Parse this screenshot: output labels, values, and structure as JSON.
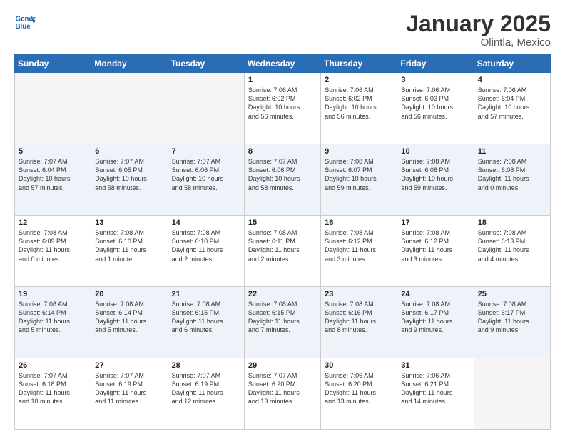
{
  "header": {
    "logo_line1": "General",
    "logo_line2": "Blue",
    "title": "January 2025",
    "subtitle": "Olintla, Mexico"
  },
  "weekdays": [
    "Sunday",
    "Monday",
    "Tuesday",
    "Wednesday",
    "Thursday",
    "Friday",
    "Saturday"
  ],
  "weeks": [
    [
      {
        "day": "",
        "info": ""
      },
      {
        "day": "",
        "info": ""
      },
      {
        "day": "",
        "info": ""
      },
      {
        "day": "1",
        "info": "Sunrise: 7:06 AM\nSunset: 6:02 PM\nDaylight: 10 hours\nand 56 minutes."
      },
      {
        "day": "2",
        "info": "Sunrise: 7:06 AM\nSunset: 6:02 PM\nDaylight: 10 hours\nand 56 minutes."
      },
      {
        "day": "3",
        "info": "Sunrise: 7:06 AM\nSunset: 6:03 PM\nDaylight: 10 hours\nand 56 minutes."
      },
      {
        "day": "4",
        "info": "Sunrise: 7:06 AM\nSunset: 6:04 PM\nDaylight: 10 hours\nand 57 minutes."
      }
    ],
    [
      {
        "day": "5",
        "info": "Sunrise: 7:07 AM\nSunset: 6:04 PM\nDaylight: 10 hours\nand 57 minutes."
      },
      {
        "day": "6",
        "info": "Sunrise: 7:07 AM\nSunset: 6:05 PM\nDaylight: 10 hours\nand 58 minutes."
      },
      {
        "day": "7",
        "info": "Sunrise: 7:07 AM\nSunset: 6:06 PM\nDaylight: 10 hours\nand 58 minutes."
      },
      {
        "day": "8",
        "info": "Sunrise: 7:07 AM\nSunset: 6:06 PM\nDaylight: 10 hours\nand 58 minutes."
      },
      {
        "day": "9",
        "info": "Sunrise: 7:08 AM\nSunset: 6:07 PM\nDaylight: 10 hours\nand 59 minutes."
      },
      {
        "day": "10",
        "info": "Sunrise: 7:08 AM\nSunset: 6:08 PM\nDaylight: 10 hours\nand 59 minutes."
      },
      {
        "day": "11",
        "info": "Sunrise: 7:08 AM\nSunset: 6:08 PM\nDaylight: 11 hours\nand 0 minutes."
      }
    ],
    [
      {
        "day": "12",
        "info": "Sunrise: 7:08 AM\nSunset: 6:09 PM\nDaylight: 11 hours\nand 0 minutes."
      },
      {
        "day": "13",
        "info": "Sunrise: 7:08 AM\nSunset: 6:10 PM\nDaylight: 11 hours\nand 1 minute."
      },
      {
        "day": "14",
        "info": "Sunrise: 7:08 AM\nSunset: 6:10 PM\nDaylight: 11 hours\nand 2 minutes."
      },
      {
        "day": "15",
        "info": "Sunrise: 7:08 AM\nSunset: 6:11 PM\nDaylight: 11 hours\nand 2 minutes."
      },
      {
        "day": "16",
        "info": "Sunrise: 7:08 AM\nSunset: 6:12 PM\nDaylight: 11 hours\nand 3 minutes."
      },
      {
        "day": "17",
        "info": "Sunrise: 7:08 AM\nSunset: 6:12 PM\nDaylight: 11 hours\nand 3 minutes."
      },
      {
        "day": "18",
        "info": "Sunrise: 7:08 AM\nSunset: 6:13 PM\nDaylight: 11 hours\nand 4 minutes."
      }
    ],
    [
      {
        "day": "19",
        "info": "Sunrise: 7:08 AM\nSunset: 6:14 PM\nDaylight: 11 hours\nand 5 minutes."
      },
      {
        "day": "20",
        "info": "Sunrise: 7:08 AM\nSunset: 6:14 PM\nDaylight: 11 hours\nand 5 minutes."
      },
      {
        "day": "21",
        "info": "Sunrise: 7:08 AM\nSunset: 6:15 PM\nDaylight: 11 hours\nand 6 minutes."
      },
      {
        "day": "22",
        "info": "Sunrise: 7:08 AM\nSunset: 6:15 PM\nDaylight: 11 hours\nand 7 minutes."
      },
      {
        "day": "23",
        "info": "Sunrise: 7:08 AM\nSunset: 6:16 PM\nDaylight: 11 hours\nand 8 minutes."
      },
      {
        "day": "24",
        "info": "Sunrise: 7:08 AM\nSunset: 6:17 PM\nDaylight: 11 hours\nand 9 minutes."
      },
      {
        "day": "25",
        "info": "Sunrise: 7:08 AM\nSunset: 6:17 PM\nDaylight: 11 hours\nand 9 minutes."
      }
    ],
    [
      {
        "day": "26",
        "info": "Sunrise: 7:07 AM\nSunset: 6:18 PM\nDaylight: 11 hours\nand 10 minutes."
      },
      {
        "day": "27",
        "info": "Sunrise: 7:07 AM\nSunset: 6:19 PM\nDaylight: 11 hours\nand 11 minutes."
      },
      {
        "day": "28",
        "info": "Sunrise: 7:07 AM\nSunset: 6:19 PM\nDaylight: 11 hours\nand 12 minutes."
      },
      {
        "day": "29",
        "info": "Sunrise: 7:07 AM\nSunset: 6:20 PM\nDaylight: 11 hours\nand 13 minutes."
      },
      {
        "day": "30",
        "info": "Sunrise: 7:06 AM\nSunset: 6:20 PM\nDaylight: 11 hours\nand 13 minutes."
      },
      {
        "day": "31",
        "info": "Sunrise: 7:06 AM\nSunset: 6:21 PM\nDaylight: 11 hours\nand 14 minutes."
      },
      {
        "day": "",
        "info": ""
      }
    ]
  ]
}
